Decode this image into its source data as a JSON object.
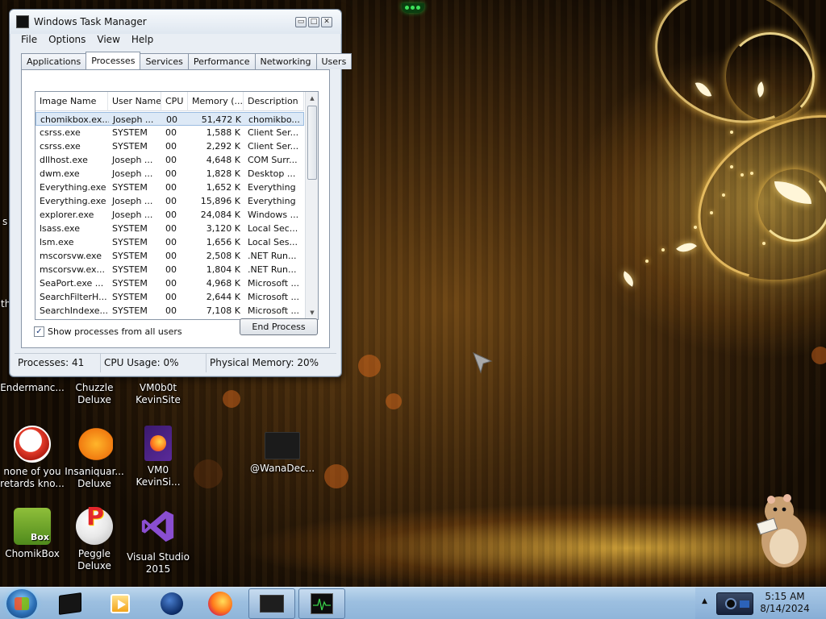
{
  "window": {
    "title": "Windows Task Manager",
    "controls": {
      "minimize": "▭",
      "maximize": "□",
      "close": "✕"
    },
    "menu": [
      "File",
      "Options",
      "View",
      "Help"
    ],
    "tabs": [
      "Applications",
      "Processes",
      "Services",
      "Performance",
      "Networking",
      "Users"
    ],
    "active_tab": "Processes"
  },
  "process_table": {
    "columns": [
      "Image Name",
      "User Name",
      "CPU",
      "Memory (...",
      "Description"
    ],
    "rows": [
      [
        "chomikbox.ex...",
        "Joseph ...",
        "00",
        "51,472 K",
        "chomikbo..."
      ],
      [
        "csrss.exe",
        "SYSTEM",
        "00",
        "1,588 K",
        "Client Ser..."
      ],
      [
        "csrss.exe",
        "SYSTEM",
        "00",
        "2,292 K",
        "Client Ser..."
      ],
      [
        "dllhost.exe",
        "Joseph ...",
        "00",
        "4,648 K",
        "COM Surr..."
      ],
      [
        "dwm.exe",
        "Joseph ...",
        "00",
        "1,828 K",
        "Desktop ..."
      ],
      [
        "Everything.exe",
        "SYSTEM",
        "00",
        "1,652 K",
        "Everything"
      ],
      [
        "Everything.exe",
        "Joseph ...",
        "00",
        "15,896 K",
        "Everything"
      ],
      [
        "explorer.exe",
        "Joseph ...",
        "00",
        "24,084 K",
        "Windows ..."
      ],
      [
        "lsass.exe",
        "SYSTEM",
        "00",
        "3,120 K",
        "Local Sec..."
      ],
      [
        "lsm.exe",
        "SYSTEM",
        "00",
        "1,656 K",
        "Local Ses..."
      ],
      [
        "mscorsvw.exe",
        "SYSTEM",
        "00",
        "2,508 K",
        ".NET Run..."
      ],
      [
        "mscorsvw.ex...",
        "SYSTEM",
        "00",
        "1,804 K",
        ".NET Run..."
      ],
      [
        "SeaPort.exe ...",
        "SYSTEM",
        "00",
        "4,968 K",
        "Microsoft ..."
      ],
      [
        "SearchFilterH...",
        "SYSTEM",
        "00",
        "2,644 K",
        "Microsoft ..."
      ],
      [
        "SearchIndexe...",
        "SYSTEM",
        "00",
        "7,108 K",
        "Microsoft ..."
      ]
    ],
    "selected_row": 0
  },
  "show_all_users": {
    "label": "Show processes from all users",
    "checked": true,
    "mark": "✓"
  },
  "end_process_label": "End Process",
  "status": {
    "processes": "Processes: 41",
    "cpu": "CPU Usage: 0%",
    "memory": "Physical Memory: 20%"
  },
  "desktop_icons": {
    "endermancer": "Endermanc...",
    "chuzzle_1": "Chuzzle",
    "chuzzle_2": "Deluxe",
    "vm0b0t_1": "VM0b0t",
    "vm0b0t_2": "KevinSite",
    "none_1": "none of you",
    "none_2": "retards kno...",
    "insaniquarium_1": "Insaniquar...",
    "insaniquarium_2": "Deluxe",
    "vm0_1": "VM0",
    "vm0_2": "KevinSi...",
    "wanadec": "@WanaDec...",
    "chomikbox": "ChomikBox",
    "peggle": "Peggle Deluxe",
    "vs_1": "Visual Studio",
    "vs_2": "2015",
    "chomikbox_badge": "Box",
    "peggle_letter": "P",
    "edge_s": "s",
    "edge_th": "th"
  },
  "tray_arrow": "▲",
  "clock": {
    "time": "5:15 AM",
    "date": "8/14/2024"
  },
  "colors": {
    "accent_selection": "#dde9f6",
    "taskbar": "#9cbfe0",
    "window_frame": "#e9eef4"
  }
}
